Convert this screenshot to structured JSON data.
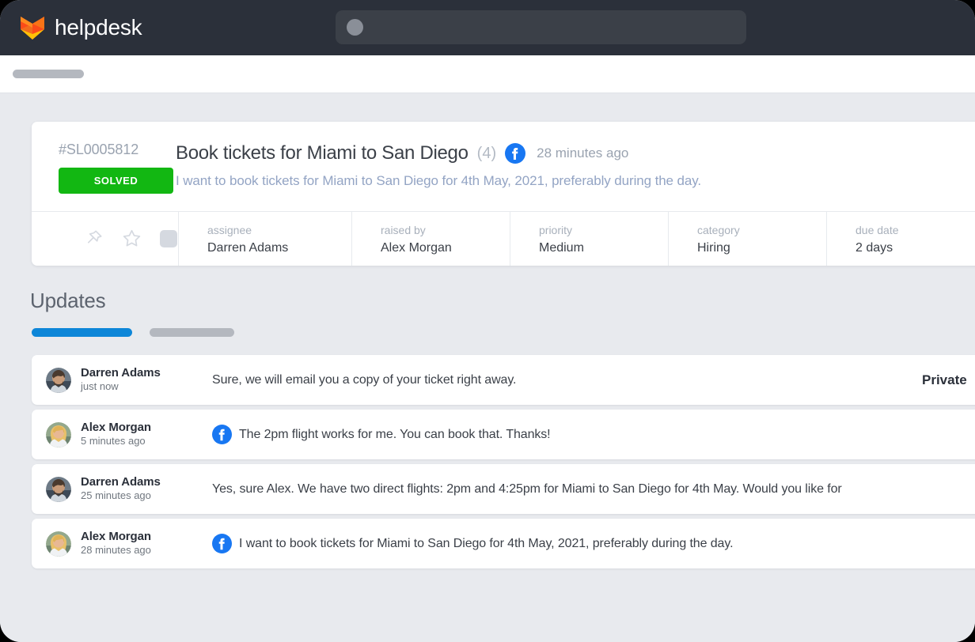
{
  "header": {
    "brand_name": "helpdesk",
    "logo_icon": "fox-chevron-logo",
    "search": {
      "icon": "search-placeholder-dot",
      "value": "",
      "placeholder": ""
    },
    "subheader_pill": "nav-placeholder-pill"
  },
  "ticket": {
    "id": "#SL0005812",
    "status": "SOLVED",
    "status_color": "#12b712",
    "title": "Book tickets for Miami to San Diego",
    "message_count": "(4)",
    "channel_icon": "facebook-icon",
    "time_ago": "28 minutes ago",
    "preview": "I want to book tickets for Miami to San Diego for 4th May, 2021, preferably during the day.",
    "actions": [
      {
        "icon": "pin-icon"
      },
      {
        "icon": "star-icon"
      },
      {
        "icon": "placeholder-square-icon"
      }
    ],
    "meta": [
      {
        "label": "assignee",
        "value": "Darren Adams"
      },
      {
        "label": "raised by",
        "value": "Alex Morgan"
      },
      {
        "label": "priority",
        "value": "Medium"
      },
      {
        "label": "category",
        "value": "Hiring"
      },
      {
        "label": "due date",
        "value": "2 days"
      }
    ]
  },
  "updates": {
    "heading": "Updates",
    "tabs": [
      {
        "state": "active",
        "accent": "#0d86d8"
      },
      {
        "state": "inactive",
        "accent": "#b4b8bf"
      }
    ],
    "messages": [
      {
        "name": "Darren Adams",
        "time": "just now",
        "avatar": "avatar-darren-adams",
        "channel_icon": "",
        "text": "Sure, we will email you a copy of your ticket right away.",
        "visibility": "Private"
      },
      {
        "name": "Alex Morgan",
        "time": "5 minutes ago",
        "avatar": "avatar-alex-morgan",
        "channel_icon": "facebook-icon",
        "text": "The 2pm flight works for me. You can book that. Thanks!",
        "visibility": ""
      },
      {
        "name": "Darren Adams",
        "time": "25 minutes ago",
        "avatar": "avatar-darren-adams",
        "channel_icon": "",
        "text": "Yes, sure Alex. We have two direct flights: 2pm and 4:25pm for Miami to San Diego for 4th May. Would you like for",
        "visibility": ""
      },
      {
        "name": "Alex Morgan",
        "time": "28 minutes ago",
        "avatar": "avatar-alex-morgan",
        "channel_icon": "facebook-icon",
        "text": "I want to book tickets for Miami to San Diego for 4th May, 2021, preferably during the day.",
        "visibility": ""
      }
    ]
  }
}
